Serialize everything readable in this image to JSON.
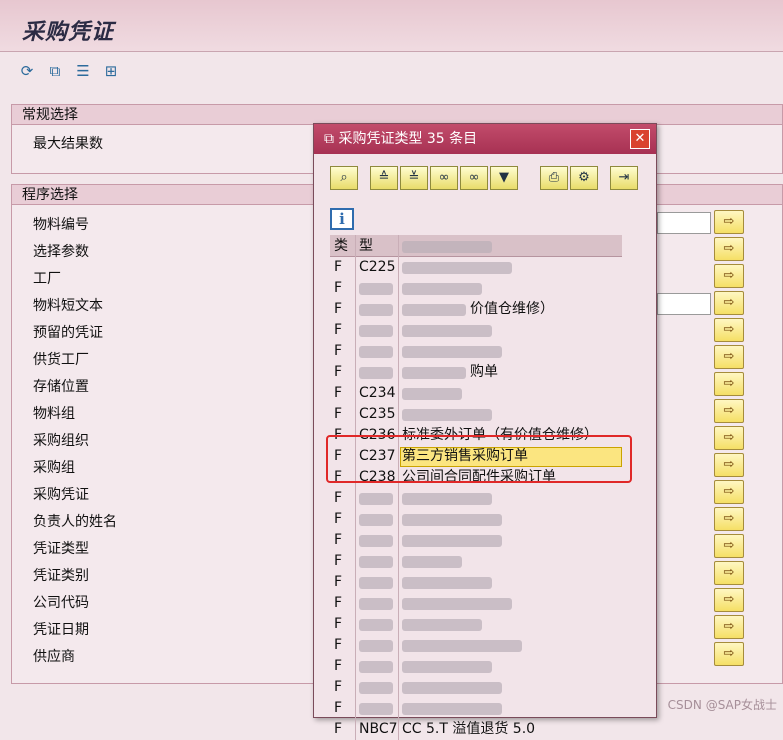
{
  "window": {
    "title": "采购凭证"
  },
  "toolbar": {
    "icons": [
      "execute-icon",
      "copy-icon",
      "variant-icon",
      "save-icon"
    ]
  },
  "group_general": {
    "title": "常规选择",
    "fields": [
      {
        "label": "最大结果数"
      }
    ]
  },
  "group_program": {
    "title": "程序选择",
    "fields": [
      {
        "label": "物料编号"
      },
      {
        "label": "选择参数"
      },
      {
        "label": "工厂"
      },
      {
        "label": "物料短文本"
      },
      {
        "label": "预留的凭证"
      },
      {
        "label": "供货工厂"
      },
      {
        "label": "存储位置"
      },
      {
        "label": "物料组"
      },
      {
        "label": "采购组织"
      },
      {
        "label": "采购组"
      },
      {
        "label": "采购凭证"
      },
      {
        "label": "负责人的姓名"
      },
      {
        "label": "凭证类型"
      },
      {
        "label": "凭证类别"
      },
      {
        "label": "公司代码"
      },
      {
        "label": "凭证日期"
      },
      {
        "label": "供应商"
      }
    ],
    "arrow_button_glyph": "⇨"
  },
  "popup": {
    "title": "采购凭证类型 35 条目",
    "title_icon": "window-icon",
    "close_glyph": "✕",
    "toolbar_icons": [
      "find-icon",
      "sort-up-icon",
      "sort-down-icon",
      "binoculars-icon",
      "binoculars-next-icon",
      "filter-icon",
      "print-icon",
      "settings-icon",
      "export-icon"
    ],
    "info_glyph": "i",
    "columns": {
      "class": "类",
      "type": "型"
    },
    "rows": [
      {
        "cls": "F",
        "type": "C225",
        "desc": ""
      },
      {
        "cls": "F",
        "type": "",
        "desc": ""
      },
      {
        "cls": "F",
        "type": "",
        "desc": "价值仓维修）"
      },
      {
        "cls": "F",
        "type": "",
        "desc": ""
      },
      {
        "cls": "F",
        "type": "",
        "desc": ""
      },
      {
        "cls": "F",
        "type": "",
        "desc": "购单"
      },
      {
        "cls": "F",
        "type": "C234",
        "desc": ""
      },
      {
        "cls": "F",
        "type": "C235",
        "desc": ""
      },
      {
        "cls": "F",
        "type": "C236",
        "desc": "标准委外订单（有价值仓维修）"
      },
      {
        "cls": "F",
        "type": "C237",
        "desc": "第三方销售采购订单",
        "selected": true
      },
      {
        "cls": "F",
        "type": "C238",
        "desc": "公司间合同配件采购订单"
      },
      {
        "cls": "F",
        "type": "",
        "desc": ""
      },
      {
        "cls": "F",
        "type": "",
        "desc": ""
      },
      {
        "cls": "F",
        "type": "",
        "desc": ""
      },
      {
        "cls": "F",
        "type": "",
        "desc": ""
      },
      {
        "cls": "F",
        "type": "",
        "desc": ""
      },
      {
        "cls": "F",
        "type": "",
        "desc": ""
      },
      {
        "cls": "F",
        "type": "",
        "desc": ""
      },
      {
        "cls": "F",
        "type": "",
        "desc": ""
      },
      {
        "cls": "F",
        "type": "",
        "desc": ""
      },
      {
        "cls": "F",
        "type": "",
        "desc": ""
      },
      {
        "cls": "F",
        "type": "",
        "desc": ""
      },
      {
        "cls": "F",
        "type": "NBC7",
        "desc": "CC 5.T 溢值退货 5.0"
      }
    ]
  },
  "watermark": "CSDN @SAP女战士"
}
